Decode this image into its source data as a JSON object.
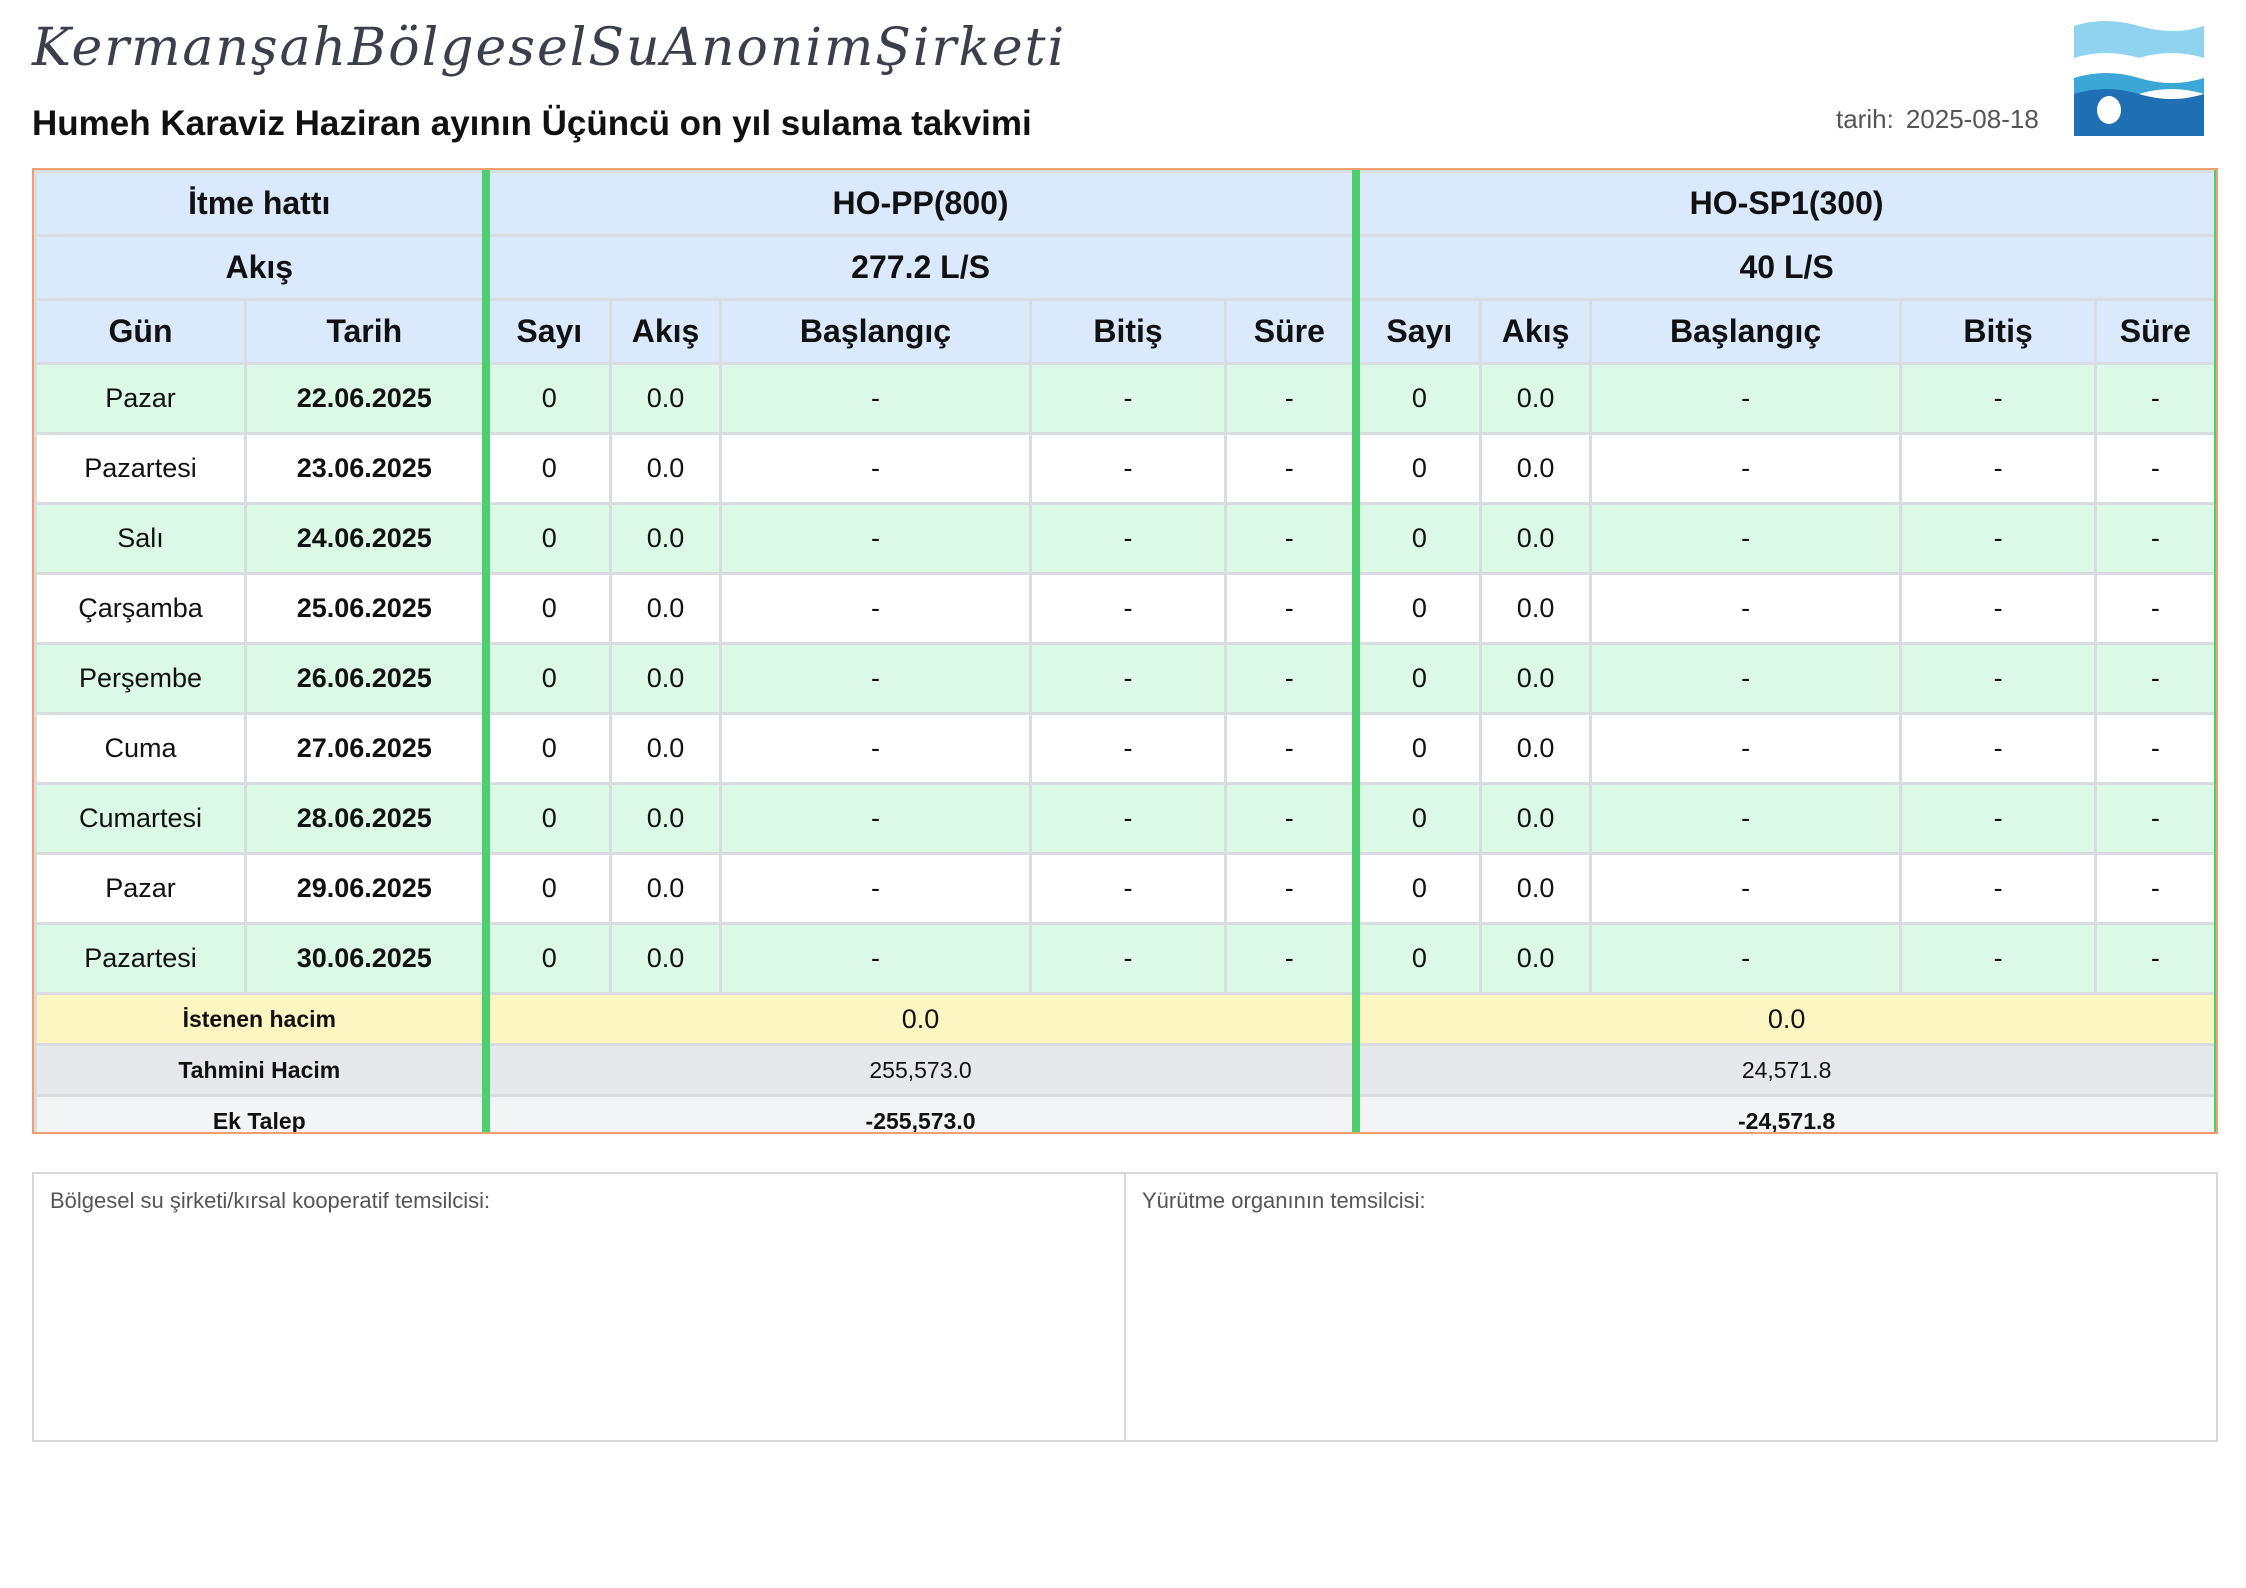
{
  "header": {
    "company": "KermanşahBölgeselSuAnonimŞirketi",
    "title": "Humeh Karaviz Haziran ayının Üçüncü on yıl sulama takvimi",
    "date_label": "tarih:",
    "date_value": "2025-08-18",
    "logo": "water-wave-logo"
  },
  "table": {
    "line_label": "İtme hattı",
    "flow_label": "Akış",
    "day_col": "Gün",
    "date_col": "Tarih",
    "sub_cols": {
      "count": "Sayı",
      "flow": "Akış",
      "start": "Başlangıç",
      "end": "Bitiş",
      "duration": "Süre"
    },
    "lines": [
      {
        "name": "HO-PP(800)",
        "flow": "277.2 L/S"
      },
      {
        "name": "HO-SP1(300)",
        "flow": "40 L/S"
      }
    ],
    "rows": [
      {
        "day": "Pazar",
        "date": "22.06.2025",
        "cells": [
          [
            "0",
            "0.0",
            "-",
            "-",
            "-"
          ],
          [
            "0",
            "0.0",
            "-",
            "-",
            "-"
          ]
        ]
      },
      {
        "day": "Pazartesi",
        "date": "23.06.2025",
        "cells": [
          [
            "0",
            "0.0",
            "-",
            "-",
            "-"
          ],
          [
            "0",
            "0.0",
            "-",
            "-",
            "-"
          ]
        ]
      },
      {
        "day": "Salı",
        "date": "24.06.2025",
        "cells": [
          [
            "0",
            "0.0",
            "-",
            "-",
            "-"
          ],
          [
            "0",
            "0.0",
            "-",
            "-",
            "-"
          ]
        ]
      },
      {
        "day": "Çarşamba",
        "date": "25.06.2025",
        "cells": [
          [
            "0",
            "0.0",
            "-",
            "-",
            "-"
          ],
          [
            "0",
            "0.0",
            "-",
            "-",
            "-"
          ]
        ]
      },
      {
        "day": "Perşembe",
        "date": "26.06.2025",
        "cells": [
          [
            "0",
            "0.0",
            "-",
            "-",
            "-"
          ],
          [
            "0",
            "0.0",
            "-",
            "-",
            "-"
          ]
        ]
      },
      {
        "day": "Cuma",
        "date": "27.06.2025",
        "cells": [
          [
            "0",
            "0.0",
            "-",
            "-",
            "-"
          ],
          [
            "0",
            "0.0",
            "-",
            "-",
            "-"
          ]
        ]
      },
      {
        "day": "Cumartesi",
        "date": "28.06.2025",
        "cells": [
          [
            "0",
            "0.0",
            "-",
            "-",
            "-"
          ],
          [
            "0",
            "0.0",
            "-",
            "-",
            "-"
          ]
        ]
      },
      {
        "day": "Pazar",
        "date": "29.06.2025",
        "cells": [
          [
            "0",
            "0.0",
            "-",
            "-",
            "-"
          ],
          [
            "0",
            "0.0",
            "-",
            "-",
            "-"
          ]
        ]
      },
      {
        "day": "Pazartesi",
        "date": "30.06.2025",
        "cells": [
          [
            "0",
            "0.0",
            "-",
            "-",
            "-"
          ],
          [
            "0",
            "0.0",
            "-",
            "-",
            "-"
          ]
        ]
      }
    ],
    "summary": {
      "requested_label": "İstenen hacim",
      "requested": [
        "0.0",
        "0.0"
      ],
      "estimated_label": "Tahmini Hacim",
      "estimated": [
        "255,573.0",
        "24,571.8"
      ],
      "extra_label": "Ek Talep",
      "extra": [
        "-255,573.0",
        "-24,571.8"
      ]
    }
  },
  "signatures": {
    "left": "Bölgesel su şirketi/kırsal kooperatif temsilcisi:",
    "right": "Yürütme organının temsilcisi:"
  },
  "colors": {
    "header_bg": "#dbe9fc",
    "row_alt_bg": "#dcf8e6",
    "group_divider": "#4dcf70",
    "requested_bg": "#fdf6c3",
    "estimated_bg": "#e6e8ec",
    "table_border": "#f0a070"
  }
}
